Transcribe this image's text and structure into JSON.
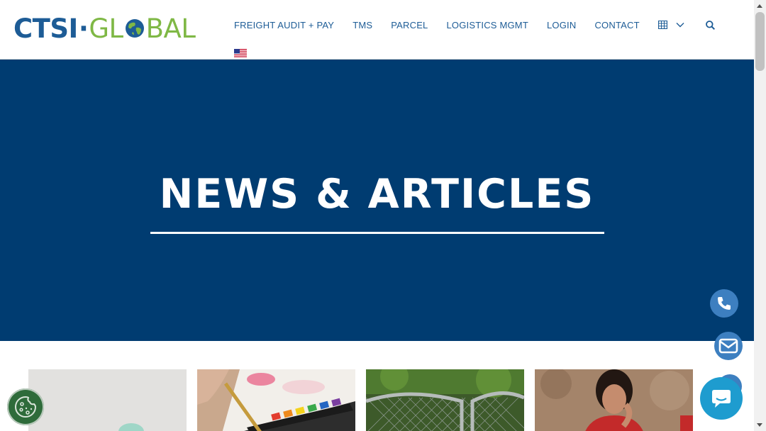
{
  "brand": {
    "logo_text_part1": "CTSI",
    "logo_text_part2": "GL",
    "logo_text_part3": "BAL",
    "colors": {
      "primary_blue": "#1d5c96",
      "logo_green": "#7fb845",
      "hero_bg": "#003c71"
    }
  },
  "nav": {
    "items": [
      "FREIGHT AUDIT + PAY",
      "TMS",
      "PARCEL",
      "LOGISTICS MGMT",
      "LOGIN",
      "CONTACT"
    ],
    "apps_icon": "grid-icon",
    "dropdown_icon": "chevron-down-icon",
    "search_icon": "search-icon",
    "language_icon": "us-flag-icon"
  },
  "hero": {
    "title": "NEWS & ARTICLES"
  },
  "articles": {
    "cards": [
      {
        "thumbnail": "abstract-gray-thumbnail"
      },
      {
        "thumbnail": "watercolor-paint-thumbnail"
      },
      {
        "thumbnail": "chain-link-gate-thumbnail"
      },
      {
        "thumbnail": "person-thinking-thumbnail"
      }
    ]
  },
  "floating": {
    "phone_icon": "phone-icon",
    "mail_icon": "mail-icon",
    "chat_icon": "chat-icon",
    "cookie_icon": "cookie-icon"
  }
}
